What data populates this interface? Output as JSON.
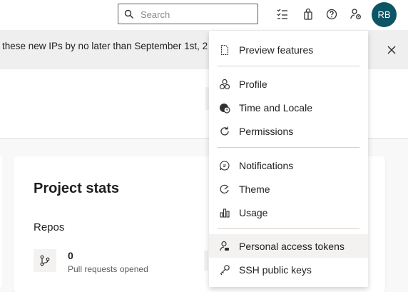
{
  "search": {
    "placeholder": "Search"
  },
  "user": {
    "initials": "RB"
  },
  "banner": {
    "text": "these new IPs by no later than September 1st, 2"
  },
  "project_stats": {
    "title": "Project stats",
    "section": "Repos",
    "pull_requests_count": "0",
    "pull_requests_label": "Pull requests opened"
  },
  "menu": {
    "items": [
      {
        "label": "Preview features",
        "icon": "page-icon"
      },
      {
        "label": "Profile",
        "icon": "profile-icon"
      },
      {
        "label": "Time and Locale",
        "icon": "globe-clock-icon"
      },
      {
        "label": "Permissions",
        "icon": "refresh-icon"
      },
      {
        "label": "Notifications",
        "icon": "chat-bubble-icon"
      },
      {
        "label": "Theme",
        "icon": "palette-icon"
      },
      {
        "label": "Usage",
        "icon": "bar-chart-icon"
      },
      {
        "label": "Personal access tokens",
        "icon": "person-key-icon"
      },
      {
        "label": "SSH public keys",
        "icon": "key-icon"
      }
    ],
    "selected_index": 7
  },
  "colors": {
    "avatar": "#0b5566",
    "menu_hover": "#f3f2f1",
    "banner": "#efefef"
  }
}
